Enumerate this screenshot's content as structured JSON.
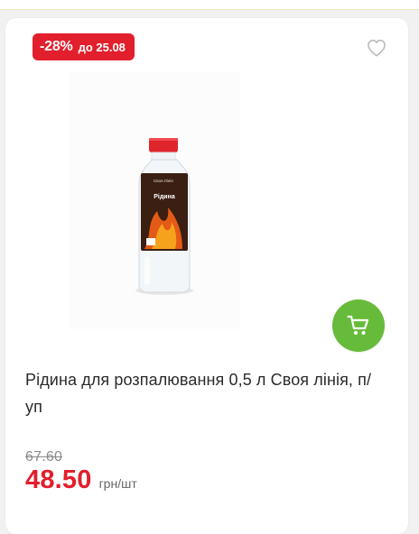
{
  "product": {
    "discount_percent": "-28%",
    "discount_until": "до 25.08",
    "title": "Рідина для розпалювання 0,5 л Своя лінія, п/уп",
    "old_price": "67.60",
    "price": "48.50",
    "unit": "грн/шт",
    "label_text": "Рідина",
    "bottle_brand": "Своя Лінія"
  },
  "colors": {
    "discount_red": "#e21f2c",
    "cart_green": "#67bb3a",
    "heart_outline": "#bdbdbd"
  },
  "icons": {
    "favorite": "heart-outline-icon",
    "cart": "cart-icon"
  }
}
